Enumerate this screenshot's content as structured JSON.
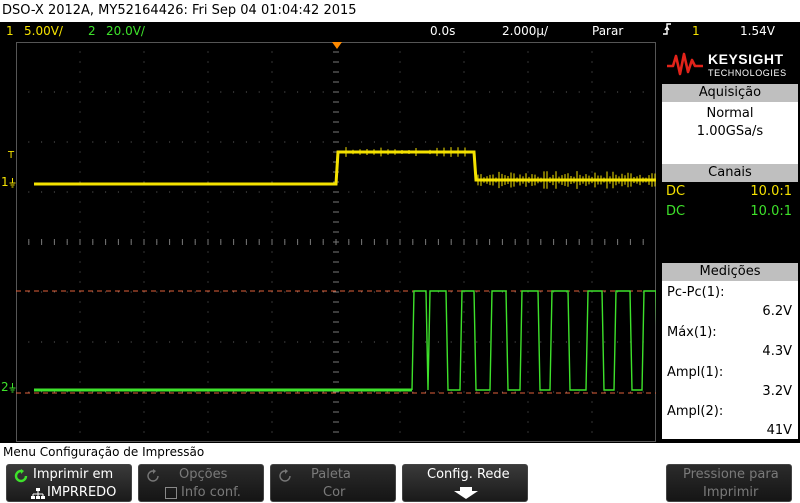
{
  "title_bar": "DSO-X 2012A, MY52164426: Fri Sep 04 01:04:42 2015",
  "status": {
    "ch1_num": "1",
    "ch1_scale": "5.00V/",
    "ch2_num": "2",
    "ch2_scale": "20.0V/",
    "time_offset": "0.0s",
    "time_scale": "2.000µ/",
    "run_state": "Parar",
    "trigger_icon": "trigger-edge-icon",
    "trigger_channel": "1",
    "trigger_level": "1.54V"
  },
  "markers": {
    "ch1": "1",
    "ch2": "2",
    "trigger": "T"
  },
  "logo": {
    "brand": "KEYSIGHT",
    "sub": "TECHNOLOGIES"
  },
  "acquisition": {
    "header": "Aquisição",
    "mode": "Normal",
    "rate": "1.00GSa/s"
  },
  "channels": {
    "header": "Canais",
    "items": [
      {
        "coupling": "DC",
        "probe": "10.0:1"
      },
      {
        "coupling": "DC",
        "probe": "10.0:1"
      }
    ]
  },
  "measurements": {
    "header": "Medições",
    "items": [
      {
        "label": "Pc-Pc(1):",
        "value": "6.2V"
      },
      {
        "label": "Máx(1):",
        "value": "4.3V"
      },
      {
        "label": "Ampl(1):",
        "value": "3.2V"
      },
      {
        "label": "Ampl(2):",
        "value": "41V"
      }
    ]
  },
  "menu_title": "Menu Configuração de Impressão",
  "softkeys": {
    "print_line1": "Imprimir em",
    "print_line2": "IMPRREDO",
    "options_line1": "Opções",
    "options_line2": "Info conf.",
    "palette_line1": "Paleta",
    "palette_line2": "Cor",
    "network": "Config. Rede",
    "press_line1": "Pressione para",
    "press_line2": "Imprimir"
  },
  "colors": {
    "ch1": "#f5e200",
    "ch2": "#3ee22b",
    "background": "#000000",
    "grid": "#5a5a5a"
  }
}
